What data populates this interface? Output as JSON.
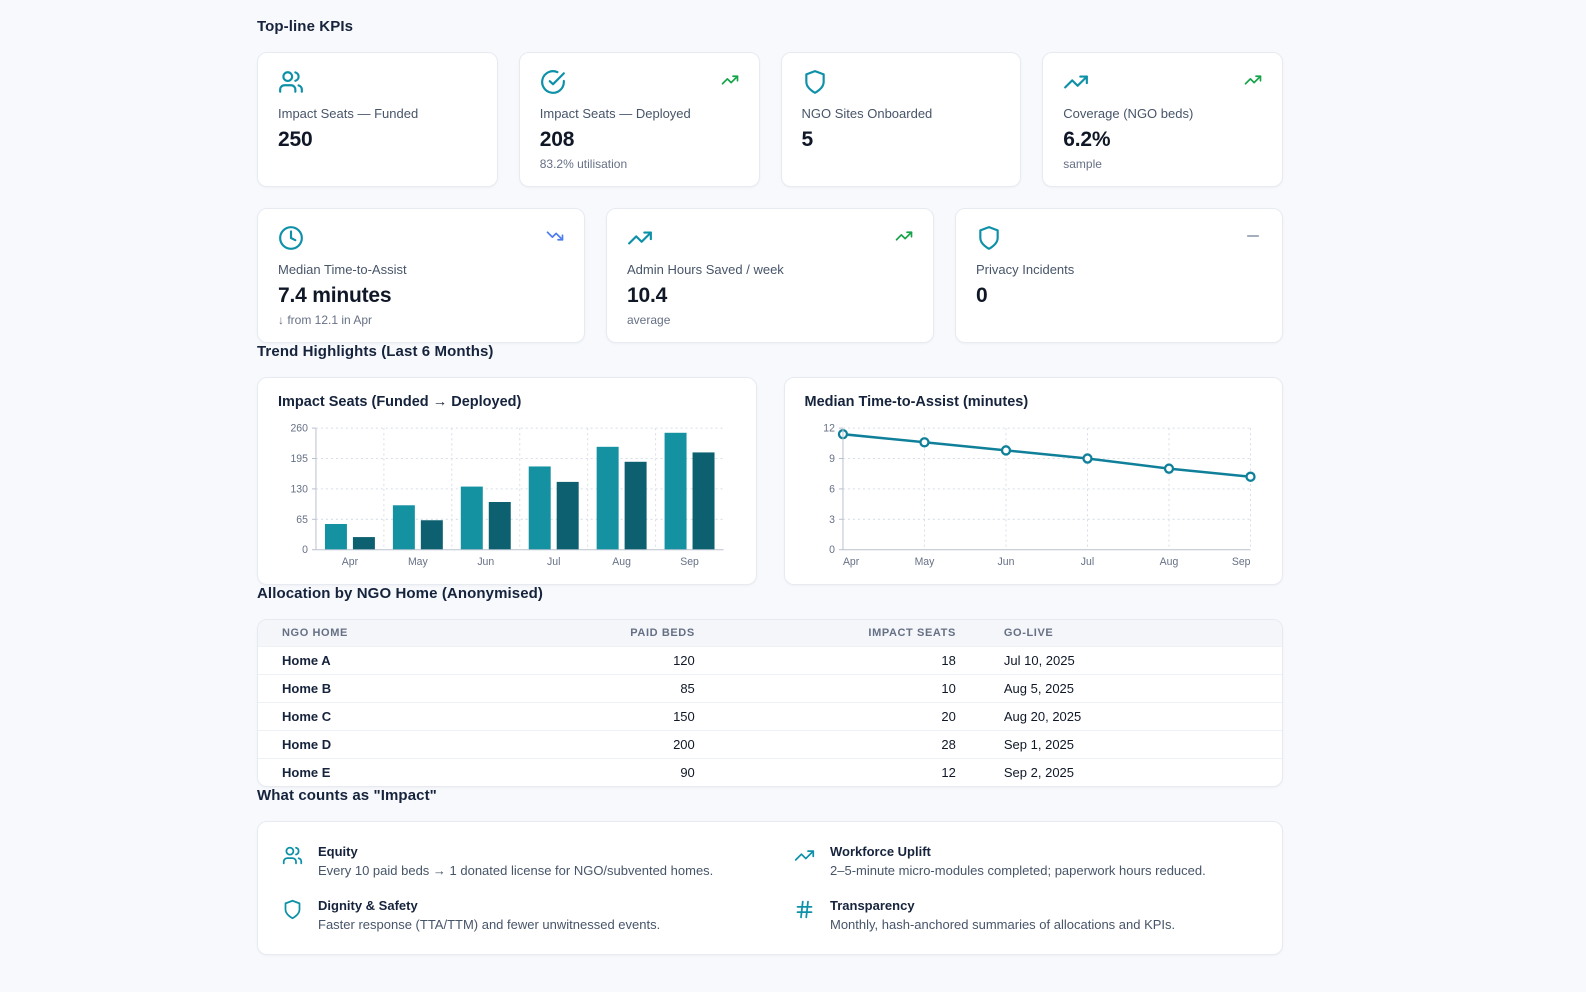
{
  "sections": {
    "kpis_title": "Top-line KPIs",
    "trends_title": "Trend Highlights (Last 6 Months)",
    "allocation_title": "Allocation by NGO Home (Anonymised)",
    "impact_title": "What counts as \"Impact\""
  },
  "colors": {
    "accent_teal": "#0e91a8",
    "positive_green": "#16a34a",
    "improving_blue": "#4d7df2",
    "neutral_gray": "#98a2b3",
    "bar_funded": "#1592a2",
    "bar_deployed": "#0d606f",
    "line_teal": "#10809a"
  },
  "kpi_row1": [
    {
      "icon": "users-icon",
      "label": "Impact Seats — Funded",
      "value": "250"
    },
    {
      "icon": "check-circle-icon",
      "trend_icon": "trending-up-icon",
      "label": "Impact Seats — Deployed",
      "value": "208",
      "sub": "83.2% utilisation"
    },
    {
      "icon": "shield-icon",
      "label": "NGO Sites Onboarded",
      "value": "5"
    },
    {
      "icon": "trending-up-icon",
      "trend_icon": "trending-up-icon",
      "label": "Coverage (NGO beds)",
      "value": "6.2%",
      "sub": "sample"
    }
  ],
  "kpi_row2": [
    {
      "icon": "clock-icon",
      "trend_icon": "trending-down-icon",
      "label": "Median Time-to-Assist",
      "value": "7.4 minutes",
      "sub": "↓ from 12.1 in Apr"
    },
    {
      "icon": "trending-up-icon",
      "trend_icon": "trending-up-icon",
      "label": "Admin Hours Saved / week",
      "value": "10.4",
      "sub": "average"
    },
    {
      "icon": "shield-icon",
      "trend_icon": "minus-icon",
      "label": "Privacy Incidents",
      "value": "0"
    }
  ],
  "chart_data": [
    {
      "type": "bar",
      "title": "Impact Seats (Funded → Deployed)",
      "categories": [
        "Apr",
        "May",
        "Jun",
        "Jul",
        "Aug",
        "Sep"
      ],
      "series": [
        {
          "name": "Funded",
          "color": "#1592a2",
          "values": [
            55,
            95,
            135,
            178,
            220,
            250
          ]
        },
        {
          "name": "Deployed",
          "color": "#0d606f",
          "values": [
            27,
            63,
            102,
            145,
            188,
            208
          ]
        }
      ],
      "xlabel": "",
      "ylabel": "",
      "ylim": [
        0,
        260
      ],
      "yticks": [
        0,
        65,
        130,
        195,
        260
      ],
      "grid": true,
      "legend": "none"
    },
    {
      "type": "line",
      "title": "Median Time-to-Assist (minutes)",
      "categories": [
        "Apr",
        "May",
        "Jun",
        "Jul",
        "Aug",
        "Sep"
      ],
      "series": [
        {
          "name": "Median TTA",
          "color": "#10809a",
          "values": [
            11.4,
            10.6,
            9.8,
            9.0,
            8.0,
            7.2
          ]
        }
      ],
      "xlabel": "",
      "ylabel": "",
      "ylim": [
        0,
        12
      ],
      "yticks": [
        0,
        3,
        6,
        9,
        12
      ],
      "grid": true,
      "legend": "none"
    }
  ],
  "table": {
    "headers": [
      "NGO HOME",
      "PAID BEDS",
      "IMPACT SEATS",
      "GO-LIVE"
    ],
    "rows": [
      {
        "home": "Home A",
        "paid_beds": "120",
        "impact_seats": "18",
        "go_live": "Jul 10, 2025"
      },
      {
        "home": "Home B",
        "paid_beds": "85",
        "impact_seats": "10",
        "go_live": "Aug 5, 2025"
      },
      {
        "home": "Home C",
        "paid_beds": "150",
        "impact_seats": "20",
        "go_live": "Aug 20, 2025"
      },
      {
        "home": "Home D",
        "paid_beds": "200",
        "impact_seats": "28",
        "go_live": "Sep 1, 2025"
      },
      {
        "home": "Home E",
        "paid_beds": "90",
        "impact_seats": "12",
        "go_live": "Sep 2, 2025"
      }
    ]
  },
  "impact_items": [
    {
      "icon": "users-icon",
      "title": "Equity",
      "desc": "Every 10 paid beds → 1 donated license for NGO/subvented homes."
    },
    {
      "icon": "trending-up-icon",
      "title": "Workforce Uplift",
      "desc": "2–5-minute micro-modules completed; paperwork hours reduced."
    },
    {
      "icon": "shield-icon",
      "title": "Dignity & Safety",
      "desc": "Faster response (TTA/TTM) and fewer unwitnessed events."
    },
    {
      "icon": "hash-icon",
      "title": "Transparency",
      "desc": "Monthly, hash-anchored summaries of allocations and KPIs."
    }
  ]
}
